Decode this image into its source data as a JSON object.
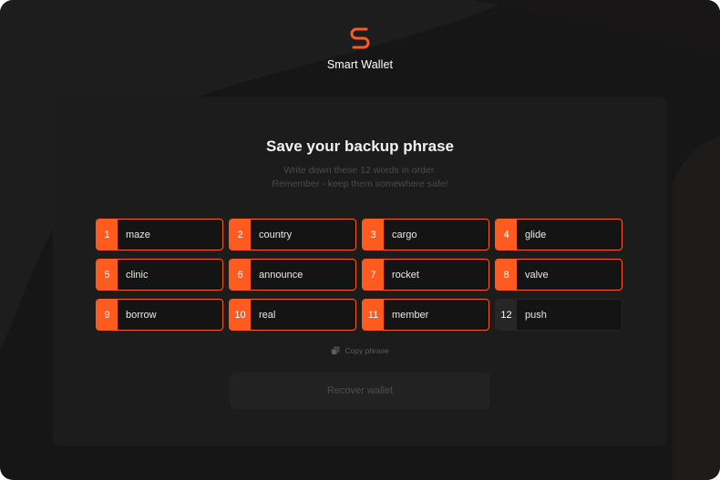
{
  "brand": {
    "name": "Smart Wallet",
    "icon": "s-logo-icon",
    "accent_color": "#ff5a1f"
  },
  "card": {
    "title": "Save your backup phrase",
    "subtitle_line1": "Write down these 12 words in order.",
    "subtitle_line2": "Remember - keep them somewhere safe!"
  },
  "words": [
    {
      "num": "1",
      "word": "maze"
    },
    {
      "num": "2",
      "word": "country"
    },
    {
      "num": "3",
      "word": "cargo"
    },
    {
      "num": "4",
      "word": "glide"
    },
    {
      "num": "5",
      "word": "clinic"
    },
    {
      "num": "6",
      "word": "announce"
    },
    {
      "num": "7",
      "word": "rocket"
    },
    {
      "num": "8",
      "word": "valve"
    },
    {
      "num": "9",
      "word": "borrow"
    },
    {
      "num": "10",
      "word": "real"
    },
    {
      "num": "11",
      "word": "member"
    },
    {
      "num": "12",
      "word": "push"
    }
  ],
  "copy": {
    "label": "Copy phrase",
    "icon": "copy-icon"
  },
  "recover_button": {
    "label": "Recover wallet"
  }
}
